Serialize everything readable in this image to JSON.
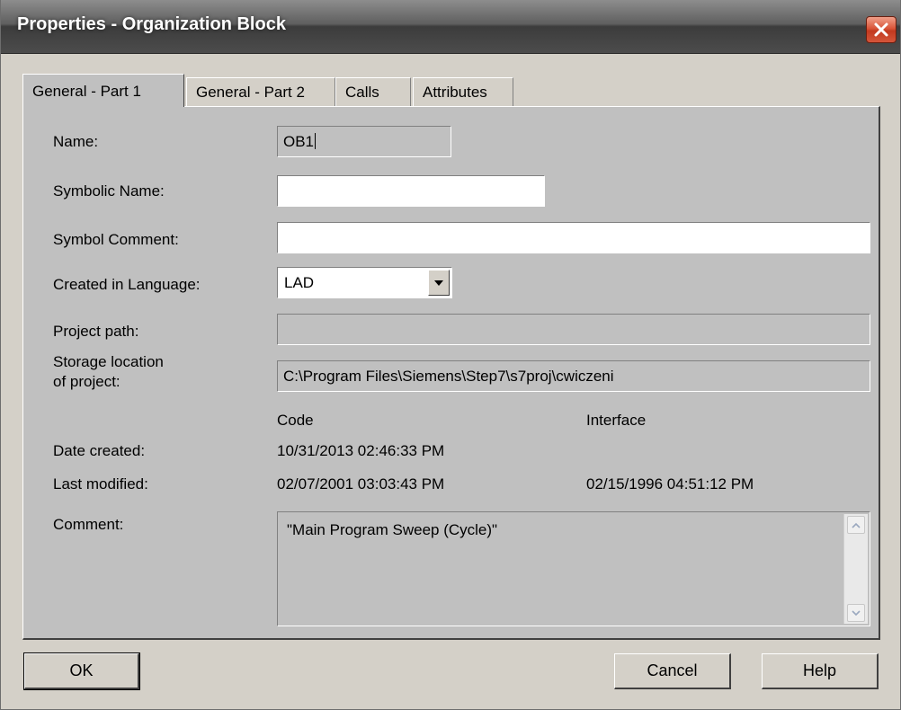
{
  "window": {
    "title": "Properties - Organization Block"
  },
  "tabs": [
    {
      "label": "General - Part 1",
      "active": true
    },
    {
      "label": "General - Part 2",
      "active": false
    },
    {
      "label": "Calls",
      "active": false
    },
    {
      "label": "Attributes",
      "active": false
    }
  ],
  "form": {
    "name_label": "Name:",
    "name_value": "OB1",
    "symbolic_name_label": "Symbolic Name:",
    "symbolic_name_value": "",
    "symbol_comment_label": "Symbol Comment:",
    "symbol_comment_value": "",
    "language_label": "Created in Language:",
    "language_value": "LAD",
    "project_path_label": "Project path:",
    "project_path_value": "",
    "storage_label_line1": "Storage location",
    "storage_label_line2": "of project:",
    "storage_value": "C:\\Program Files\\Siemens\\Step7\\s7proj\\cwiczeni",
    "code_header": "Code",
    "interface_header": "Interface",
    "date_created_label": "Date created:",
    "date_created_code": "10/31/2013 02:46:33 PM",
    "last_modified_label": "Last modified:",
    "last_modified_code": "02/07/2001 03:03:43 PM",
    "last_modified_interface": "02/15/1996 04:51:12 PM",
    "comment_label": "Comment:",
    "comment_value": "\"Main Program Sweep (Cycle)\""
  },
  "buttons": {
    "ok": "OK",
    "cancel": "Cancel",
    "help": "Help"
  },
  "colors": {
    "close_button": "#c23a1f",
    "dialog_face": "#c0c0c0"
  }
}
